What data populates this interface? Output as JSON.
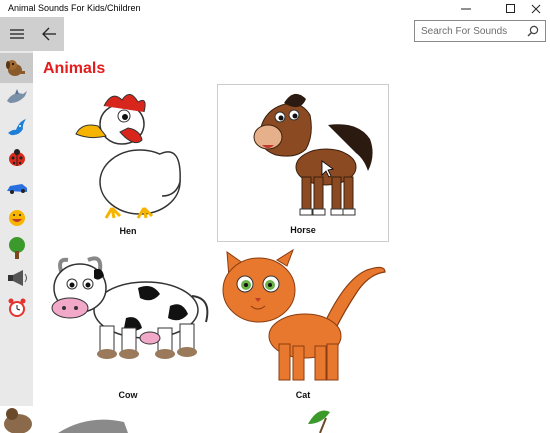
{
  "window": {
    "title": "Animal Sounds For Kids/Children",
    "minimize_icon": "minimize-icon",
    "maximize_icon": "maximize-icon",
    "close_icon": "close-icon"
  },
  "toolbar": {
    "menu_icon": "hamburger-icon",
    "back_icon": "back-arrow-icon"
  },
  "search": {
    "placeholder": "Search For Sounds",
    "value": "",
    "icon": "search-icon"
  },
  "sidebar": {
    "items": [
      {
        "icon": "dog-icon",
        "active": true
      },
      {
        "icon": "dolphin-icon",
        "active": false
      },
      {
        "icon": "bird-icon",
        "active": false
      },
      {
        "icon": "ladybug-icon",
        "active": false
      },
      {
        "icon": "car-icon",
        "active": false
      },
      {
        "icon": "emoji-face-icon",
        "active": false
      },
      {
        "icon": "tree-icon",
        "active": false
      },
      {
        "icon": "horn-icon",
        "active": false
      },
      {
        "icon": "alarm-clock-icon",
        "active": false
      }
    ]
  },
  "main": {
    "heading": "Animals",
    "tiles": [
      {
        "label": "Hen",
        "image": "hen-image",
        "selected": false
      },
      {
        "label": "Horse",
        "image": "horse-image",
        "selected": true
      },
      {
        "label": "Cow",
        "image": "cow-image",
        "selected": false
      },
      {
        "label": "Cat",
        "image": "cat-image",
        "selected": false
      }
    ]
  },
  "colors": {
    "heading": "#e51c1c",
    "sidebar_bg": "#e9e9e9",
    "toolbar_button_bg": "#cfcfcf"
  }
}
